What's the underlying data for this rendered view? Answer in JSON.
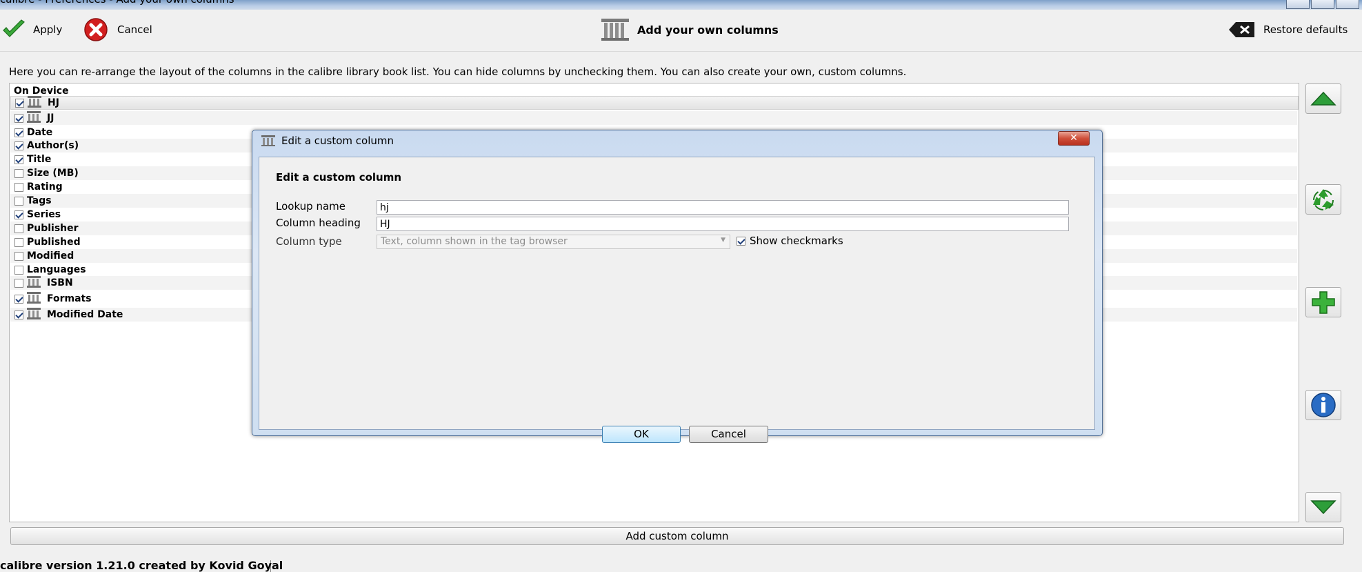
{
  "window": {
    "title": "calibre - Preferences - Add your own columns"
  },
  "toolbar": {
    "apply_label": "Apply",
    "cancel_label": "Cancel",
    "page_title": "Add your own columns",
    "restore_label": "Restore defaults"
  },
  "description": "Here you can re-arrange the layout of the columns in the calibre library book list. You can hide columns by unchecking them. You can also create your own, custom columns.",
  "column_list": {
    "header": "On Device",
    "rows": [
      {
        "label": "HJ",
        "checked": true,
        "custom": true,
        "selected": true
      },
      {
        "label": "JJ",
        "checked": true,
        "custom": true
      },
      {
        "label": "Date",
        "checked": true,
        "custom": false
      },
      {
        "label": "Author(s)",
        "checked": true,
        "custom": false
      },
      {
        "label": "Title",
        "checked": true,
        "custom": false
      },
      {
        "label": "Size (MB)",
        "checked": false,
        "custom": false
      },
      {
        "label": "Rating",
        "checked": false,
        "custom": false
      },
      {
        "label": "Tags",
        "checked": false,
        "custom": false
      },
      {
        "label": "Series",
        "checked": true,
        "custom": false
      },
      {
        "label": "Publisher",
        "checked": false,
        "custom": false
      },
      {
        "label": "Published",
        "checked": false,
        "custom": false
      },
      {
        "label": "Modified",
        "checked": false,
        "custom": false
      },
      {
        "label": "Languages",
        "checked": false,
        "custom": false
      },
      {
        "label": "ISBN",
        "checked": false,
        "custom": true
      },
      {
        "label": "Formats",
        "checked": true,
        "custom": true
      },
      {
        "label": "Modified Date",
        "checked": true,
        "custom": true
      }
    ]
  },
  "side_buttons": [
    "move-up-icon",
    "delete-recycle-icon",
    "add-plus-icon",
    "info-icon",
    "move-down-icon"
  ],
  "add_custom_column_label": "Add custom column",
  "status": {
    "version_text": "calibre version 1.21.0 created by Kovid Goyal"
  },
  "dialog": {
    "title": "Edit a custom column",
    "heading": "Edit a custom column",
    "lookup_label": "Lookup name",
    "lookup_value": "hj",
    "heading_label": "Column heading",
    "heading_value": "HJ",
    "type_label": "Column type",
    "type_value": "Text, column shown in the tag browser",
    "show_checkmarks_label": "Show checkmarks",
    "show_checkmarks_checked": true,
    "ok_label": "OK",
    "cancel_label": "Cancel"
  },
  "colors": {
    "dialog_frame": "#c9daf0",
    "close_button": "#cf4f3a",
    "arrow_green": "#2e9e3a",
    "info_blue": "#2a6cc4"
  }
}
